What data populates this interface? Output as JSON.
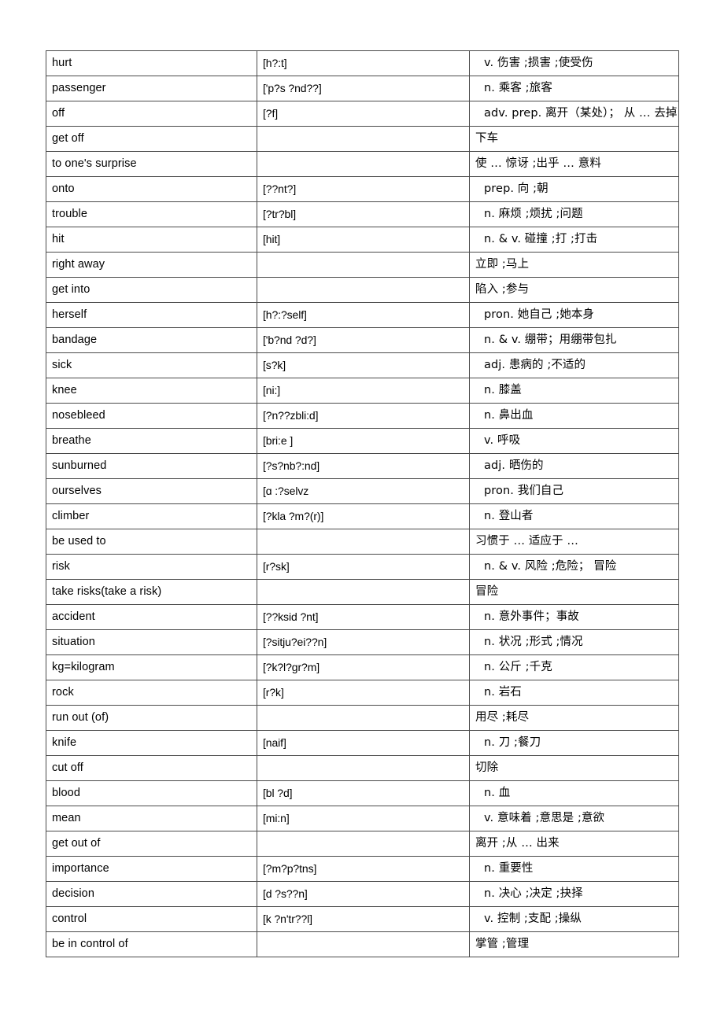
{
  "document": {
    "type": "vocabulary-table",
    "columns": [
      "word",
      "phonetic",
      "definition"
    ],
    "row_count": 34
  },
  "rows": [
    {
      "word": "hurt",
      "phonetic": "[h?:t]",
      "definition": "v.  伤害 ;损害 ;使受伤",
      "pos": true
    },
    {
      "word": "passenger",
      "phonetic": "['p?s ?nd??]",
      "definition": "n.  乘客 ;旅客",
      "pos": true
    },
    {
      "word": "off",
      "phonetic": "[?f]",
      "definition": "adv. prep.  离开（某处）； 从 … 去掉",
      "pos": true
    },
    {
      "word": "get off",
      "phonetic": "",
      "definition": "下车",
      "pos": false
    },
    {
      "word": "to one's surprise",
      "phonetic": "",
      "definition": "使 … 惊讶 ;出乎 … 意料",
      "pos": false
    },
    {
      "word": "onto",
      "phonetic": "[??nt?]",
      "definition": "prep.  向 ;朝",
      "pos": true
    },
    {
      "word": "trouble",
      "phonetic": "[?tr?bl]",
      "definition": "n.  麻烦 ;烦扰 ;问题",
      "pos": true
    },
    {
      "word": "hit",
      "phonetic": "[hit]",
      "definition": "n. & v.  碰撞 ;打 ;打击",
      "pos": true
    },
    {
      "word": "right away",
      "phonetic": "",
      "definition": "立即 ;马上",
      "pos": false
    },
    {
      "word": "get into",
      "phonetic": "",
      "definition": "陷入 ;参与",
      "pos": false
    },
    {
      "word": "herself",
      "phonetic": "[h?:?self]",
      "definition": "pron.  她自己 ;她本身",
      "pos": true
    },
    {
      "word": "bandage",
      "phonetic": "['b?nd ?d?]",
      "definition": "n. & v.  绷带；用绷带包扎",
      "pos": true
    },
    {
      "word": "sick",
      "phonetic": "[s?k]",
      "definition": "adj.  患病的 ;不适的",
      "pos": true
    },
    {
      "word": "knee",
      "phonetic": "[ni:]",
      "definition": "n.  膝盖",
      "pos": true
    },
    {
      "word": "nosebleed",
      "phonetic": "[?n??zbli:d]",
      "definition": "n.  鼻出血",
      "pos": true
    },
    {
      "word": "breathe",
      "phonetic": "[bri:e ]",
      "definition": "v.  呼吸",
      "pos": true
    },
    {
      "word": "sunburned",
      "phonetic": "[?s?nb?:nd]",
      "definition": "adj.  晒伤的",
      "pos": true
    },
    {
      "word": "ourselves",
      "phonetic": "[ɑ  :?selvz",
      "definition": "pron.  我们自己",
      "pos": true
    },
    {
      "word": "climber",
      "phonetic": "[?kla ?m?(r)]",
      "definition": "n.  登山者",
      "pos": true
    },
    {
      "word": "be used to",
      "phonetic": "",
      "definition": "习惯于 …  适应于 …",
      "pos": false
    },
    {
      "word": "risk",
      "phonetic": "[r?sk]",
      "definition": "n. & v.  风险 ;危险； 冒险",
      "pos": true
    },
    {
      "word": "take risks(take a risk)",
      "phonetic": "",
      "definition": "冒险",
      "pos": false
    },
    {
      "word": "accident",
      "phonetic": "[??ksid ?nt]",
      "definition": "n.  意外事件；事故",
      "pos": true
    },
    {
      "word": "situation",
      "phonetic": "[?sitju?ei??n]",
      "definition": "n.  状况 ;形式 ;情况",
      "pos": true
    },
    {
      "word": "kg=kilogram",
      "phonetic": "[?k?l?gr?m]",
      "definition": "n.  公斤 ;千克",
      "pos": true
    },
    {
      "word": "rock",
      "phonetic": "[r?k]",
      "definition": "n.  岩石",
      "pos": true
    },
    {
      "word": "run out (of)",
      "phonetic": "",
      "definition": "用尽 ;耗尽",
      "pos": false
    },
    {
      "word": "knife",
      "phonetic": "[naif]",
      "definition": "n.  刀 ;餐刀",
      "pos": true
    },
    {
      "word": "cut off",
      "phonetic": "",
      "definition": "切除",
      "pos": false
    },
    {
      "word": "blood",
      "phonetic": "[bl ?d]",
      "definition": "n.  血",
      "pos": true
    },
    {
      "word": "mean",
      "phonetic": "[mi:n]",
      "definition": "v.  意味着 ;意思是 ;意欲",
      "pos": true
    },
    {
      "word": "get out of",
      "phonetic": "",
      "definition": "离开 ;从 …  出来",
      "pos": false
    },
    {
      "word": "importance",
      "phonetic": "[?m?p?tns]",
      "definition": "n.  重要性",
      "pos": true
    },
    {
      "word": "decision",
      "phonetic": "[d ?s??n]",
      "definition": "n.  决心 ;决定 ;抉择",
      "pos": true
    },
    {
      "word": "control",
      "phonetic": "[k ?n'tr??l]",
      "definition": "v.  控制 ;支配 ;操纵",
      "pos": true
    },
    {
      "word": "be in control of",
      "phonetic": "",
      "definition": "掌管 ;管理",
      "pos": false
    }
  ]
}
